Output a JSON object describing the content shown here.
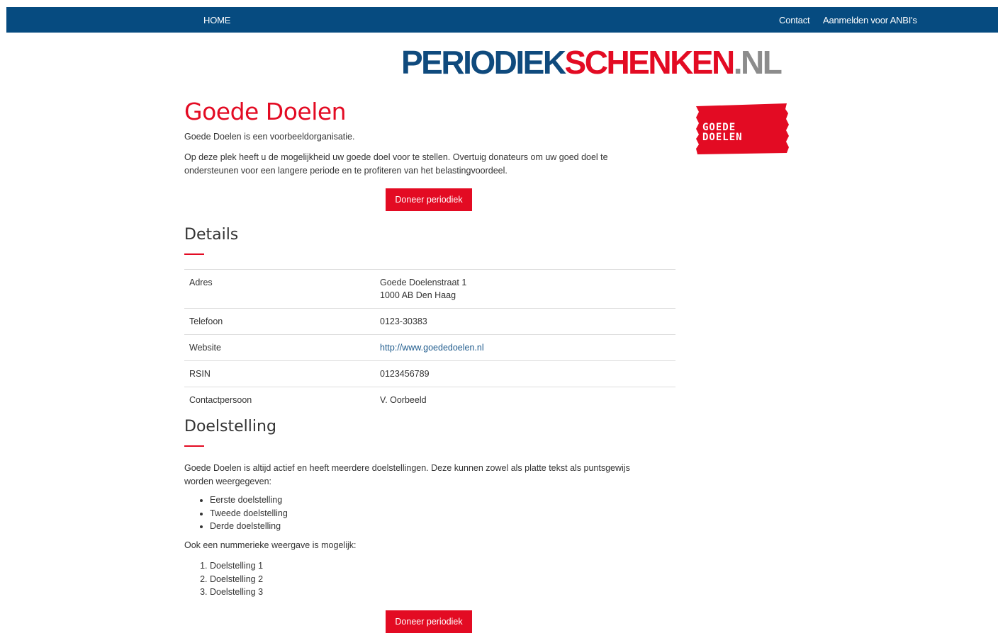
{
  "nav": {
    "home": "HOME",
    "contact": "Contact",
    "anbi": "Aanmelden voor ANBI's"
  },
  "logo": {
    "part1": "PERIODIEK",
    "part2": "SCHENKEN",
    "part3": ".",
    "part4": "NL"
  },
  "org": {
    "name": "Goede Doelen",
    "logo_line1": "GOEDE",
    "logo_line2": "DOELEN",
    "intro": "Goede Doelen is een voorbeeldorganisatie.",
    "description": "Op deze plek heeft u de mogelijkheid uw goede doel voor te stellen. Overtuig donateurs om uw goed doel te ondersteunen voor een langere periode en te profiteren van het belastingvoordeel.",
    "donate_label": "Doneer periodiek"
  },
  "details": {
    "heading": "Details",
    "rows": {
      "adres_label": "Adres",
      "adres_line1": "Goede Doelenstraat 1",
      "adres_line2": "1000 AB Den Haag",
      "telefoon_label": "Telefoon",
      "telefoon": "0123-30383",
      "website_label": "Website",
      "website": "http://www.goededoelen.nl",
      "rsin_label": "RSIN",
      "rsin": "0123456789",
      "contact_label": "Contactpersoon",
      "contact": "V. Oorbeeld"
    }
  },
  "doelstelling": {
    "heading": "Doelstelling",
    "text": "Goede Doelen is altijd actief en heeft meerdere doelstellingen. Deze kunnen zowel als platte tekst als puntsgewijs worden weergegeven:",
    "bullets": [
      "Eerste doelstelling",
      "Tweede doelstelling",
      "Derde doelstelling"
    ],
    "numbered_intro": "Ook een nummerieke weergave is mogelijk:",
    "numbered": [
      "Doelstelling 1",
      "Doelstelling 2",
      "Doelstelling 3"
    ]
  },
  "colors": {
    "nav_bg": "#064b80",
    "accent_red": "#e30b23",
    "logo_blue": "#0f4a7d",
    "logo_gray": "#8c8c8c"
  }
}
